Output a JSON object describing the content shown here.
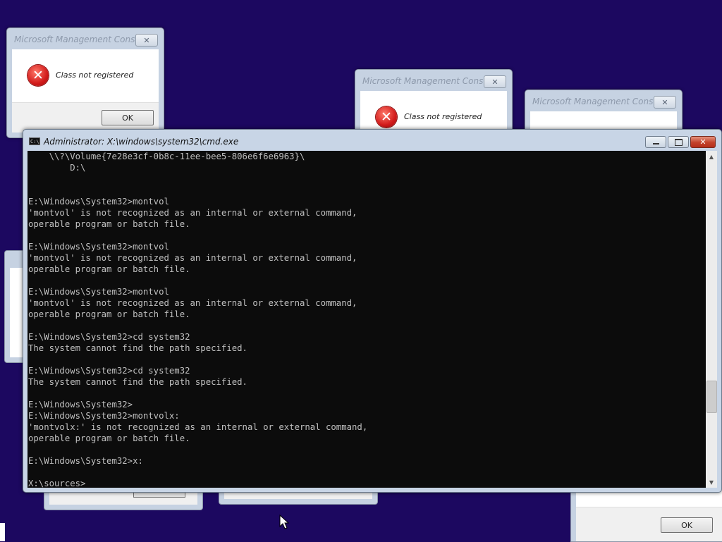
{
  "dialogs": [
    {
      "title": "Microsoft Management Console",
      "message": "Class not registered",
      "ok": "OK"
    },
    {
      "title": "Microsoft Management Console",
      "message": "Class not registered"
    },
    {
      "title": "Microsoft Management Console"
    }
  ],
  "bottom_right_dialog": {
    "ok": "OK"
  },
  "cmd": {
    "title": "Administrator: X:\\windows\\system32\\cmd.exe",
    "icon_text": "C:\\",
    "lines": [
      "    \\\\?\\Volume{7e28e3cf-0b8c-11ee-bee5-806e6f6e6963}\\",
      "        D:\\",
      "",
      "",
      "E:\\Windows\\System32>montvol",
      "'montvol' is not recognized as an internal or external command,",
      "operable program or batch file.",
      "",
      "E:\\Windows\\System32>montvol",
      "'montvol' is not recognized as an internal or external command,",
      "operable program or batch file.",
      "",
      "E:\\Windows\\System32>montvol",
      "'montvol' is not recognized as an internal or external command,",
      "operable program or batch file.",
      "",
      "E:\\Windows\\System32>cd system32",
      "The system cannot find the path specified.",
      "",
      "E:\\Windows\\System32>cd system32",
      "The system cannot find the path specified.",
      "",
      "E:\\Windows\\System32>",
      "E:\\Windows\\System32>montvolx:",
      "'montvolx:' is not recognized as an internal or external command,",
      "operable program or batch file.",
      "",
      "E:\\Windows\\System32>x:",
      "",
      "X:\\sources>"
    ]
  },
  "colors": {
    "desktop": "#1c0860",
    "console_bg": "#0c0c0c",
    "console_text": "#c0c0c0",
    "close_red": "#c2422a"
  },
  "icons": [
    "error-icon",
    "close-icon",
    "minimize-icon",
    "maximize-icon",
    "cmd-icon",
    "mouse-cursor-icon"
  ]
}
